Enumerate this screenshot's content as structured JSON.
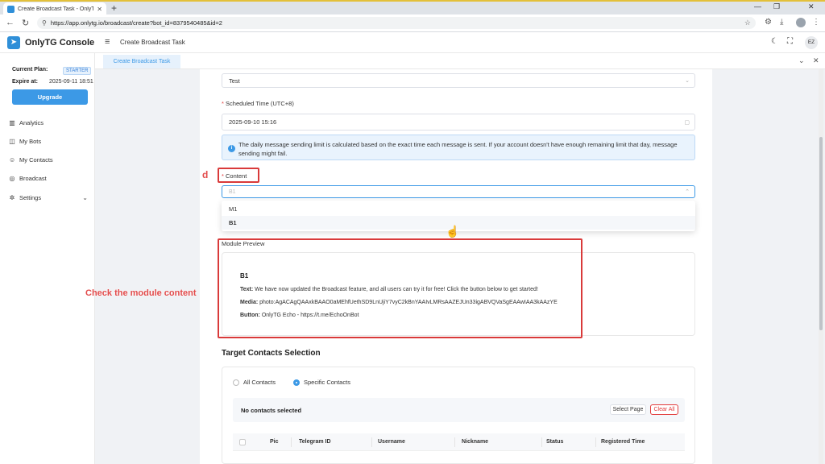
{
  "browser": {
    "tab_title": "Create Broadcast Task - OnlyTG C",
    "url": "https://app.onlytg.io/broadcast/create?bot_id=8379540485&id=2"
  },
  "header": {
    "brand": "OnlyTG Console",
    "breadcrumb": "Create Broadcast Task",
    "avatar_initials": "EZ"
  },
  "sidebar": {
    "plan_label": "Current Plan:",
    "plan_value": "STARTER",
    "expire_label": "Expire at:",
    "expire_value": "2025-09-11 18:51",
    "upgrade_label": "Upgrade",
    "items": [
      {
        "label": "Analytics",
        "icon": "chart-icon"
      },
      {
        "label": "My Bots",
        "icon": "bot-icon"
      },
      {
        "label": "My Contacts",
        "icon": "contacts-icon"
      },
      {
        "label": "Broadcast",
        "icon": "broadcast-icon"
      },
      {
        "label": "Settings",
        "icon": "gear-icon"
      }
    ]
  },
  "page_tab": "Create Broadcast Task",
  "form": {
    "bot_select_value": "Test",
    "schedule_label": "Scheduled Time (UTC+8)",
    "schedule_value": "2025-09-10 15:16",
    "info_text": "The daily message sending limit is calculated based on the exact time each message is sent. If your account doesn't have enough remaining limit that day, message sending might fail.",
    "content_label": "Content",
    "content_placeholder": "B1",
    "content_options": [
      "M1",
      "B1"
    ],
    "selected_option": "B1"
  },
  "preview": {
    "label": "Module Preview",
    "title": "B1",
    "text_label": "Text:",
    "text_value": "We have now updated the Broadcast feature, and all users can try it for free! Click the button below to get started!",
    "media_label": "Media:",
    "media_value": "photo:AgACAgQAAxkBAAO0aMEhfUethSD9LnUjiY7vyC2kBnYAAIvLMRsAAZEJUn33igABVQVaSgEAAwIAA3kAAzYE",
    "button_label": "Button:",
    "button_value": "OnlyTG Echo - https://t.me/EchoOnBot"
  },
  "contacts": {
    "section_title": "Target Contacts Selection",
    "radio_all": "All Contacts",
    "radio_specific": "Specific Contacts",
    "selected_text": "No contacts selected",
    "select_page": "Select Page",
    "clear_all": "Clear All",
    "columns": [
      "Pic",
      "Telegram ID",
      "Username",
      "Nickname",
      "Status",
      "Registered Time"
    ]
  },
  "annotations": {
    "step_marker": "d",
    "callout": "Check the module content"
  },
  "colors": {
    "accent": "#3c99e6",
    "annotation_red": "#d93a3a",
    "required": "#e23c3c"
  }
}
